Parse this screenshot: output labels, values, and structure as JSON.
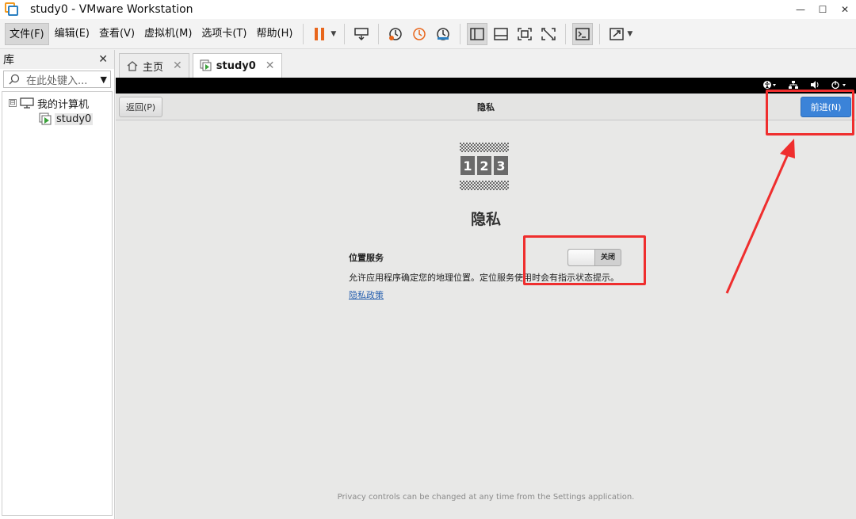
{
  "window": {
    "title": "study0 - VMware Workstation",
    "controls": {
      "minimize": "—",
      "maximize": "☐",
      "close": "✕"
    }
  },
  "menu": {
    "items": [
      "文件(F)",
      "编辑(E)",
      "查看(V)",
      "虚拟机(M)",
      "选项卡(T)",
      "帮助(H)"
    ],
    "active_index": 0
  },
  "library": {
    "title": "库",
    "close": "✕",
    "search_placeholder": "在此处键入...",
    "tree": {
      "root": "我的计算机",
      "expander": "⊟",
      "children": [
        "study0"
      ]
    }
  },
  "tabs": [
    {
      "label": "主页",
      "close": "✕",
      "icon": "home-icon"
    },
    {
      "label": "study0",
      "close": "✕",
      "icon": "vm-play-icon"
    }
  ],
  "vm": {
    "topbar_icons": [
      "accessibility-icon",
      "network-icon",
      "volume-icon",
      "power-icon"
    ],
    "header": {
      "back": "返回(P)",
      "title": "隐私",
      "next": "前进(N)"
    },
    "page": {
      "title": "隐私",
      "location_service_label": "位置服务",
      "toggle_state": "关闭",
      "description": "允许应用程序确定您的地理位置。定位服务使用时会有指示状态提示。",
      "policy_link": "隐私政策",
      "icon_digits": [
        "1",
        "2",
        "3"
      ],
      "footer": "Privacy controls can be changed at any time from the Settings application."
    }
  },
  "colors": {
    "annotation": "#ef2e2e",
    "next_button": "#3b83d8",
    "link": "#2a62b0"
  }
}
